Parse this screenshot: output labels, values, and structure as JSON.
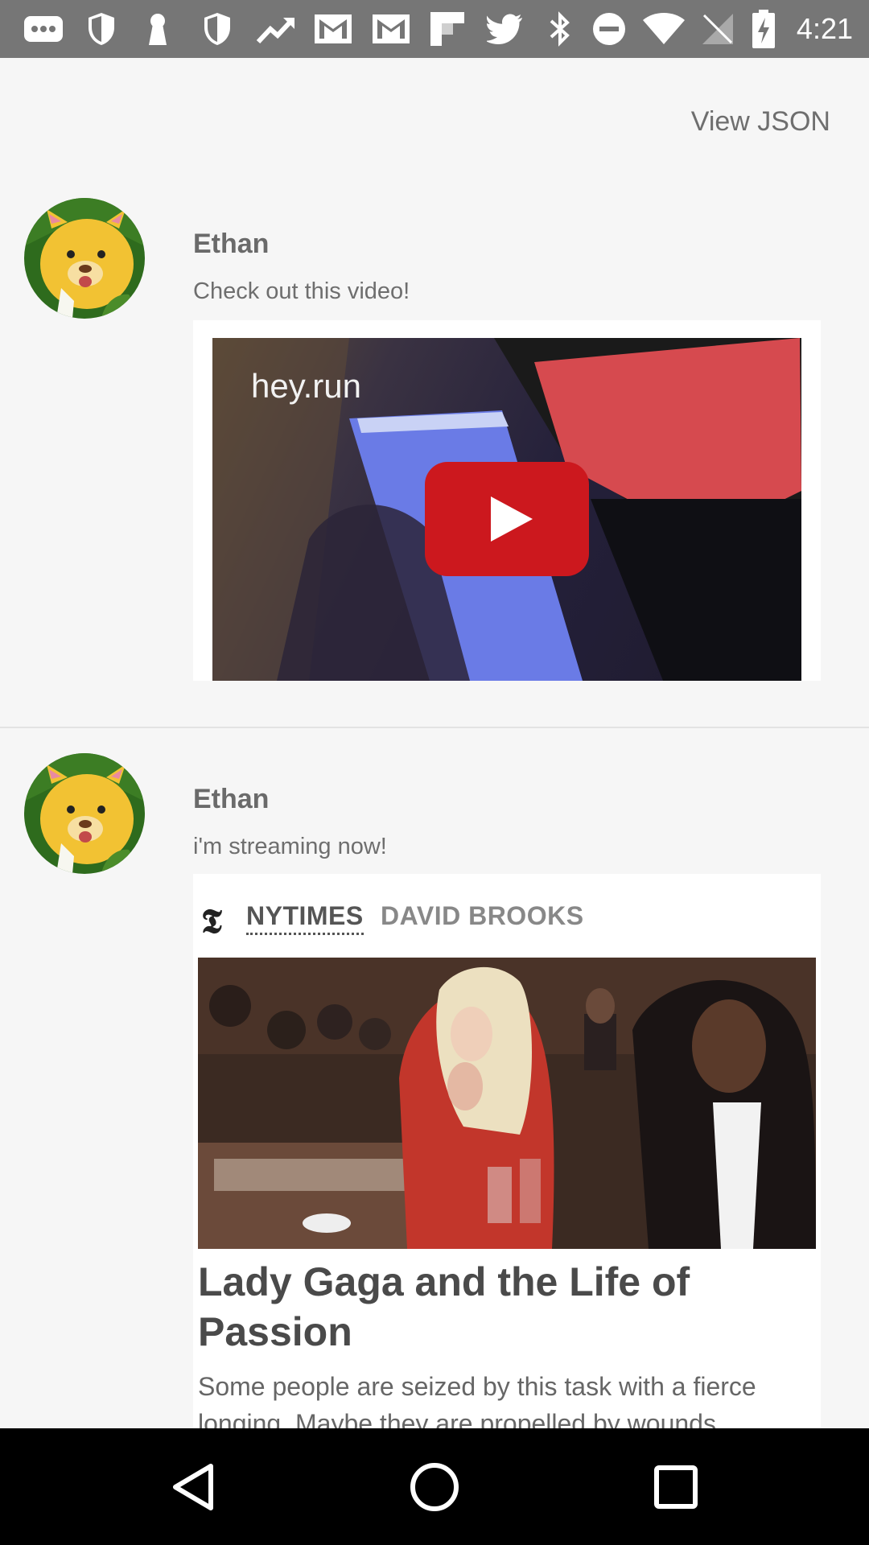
{
  "status_bar": {
    "time": "4:21",
    "icons": [
      "messages-icon",
      "shield-icon",
      "keyhole-icon",
      "shield-icon",
      "trending-icon",
      "gmail-icon",
      "gmail-icon",
      "flipboard-icon",
      "twitter-icon",
      "bluetooth-icon",
      "do-not-disturb-icon",
      "wifi-icon",
      "no-signal-icon",
      "battery-charging-icon"
    ]
  },
  "header": {
    "view_json_label": "View JSON"
  },
  "posts": [
    {
      "author": "Ethan",
      "message": "Check out this video!",
      "video": {
        "title": "hey.run"
      }
    },
    {
      "author": "Ethan",
      "message": "i'm streaming now!",
      "article": {
        "source": "NYTIMES",
        "byline": "DAVID BROOKS",
        "title": "Lady Gaga and the Life of Passion",
        "description": "Some people are seized by this task with a fierce longing. Maybe they are propelled by wounds"
      }
    }
  ],
  "nav_bar": {
    "buttons": [
      "back-icon",
      "home-icon",
      "recents-icon"
    ]
  }
}
